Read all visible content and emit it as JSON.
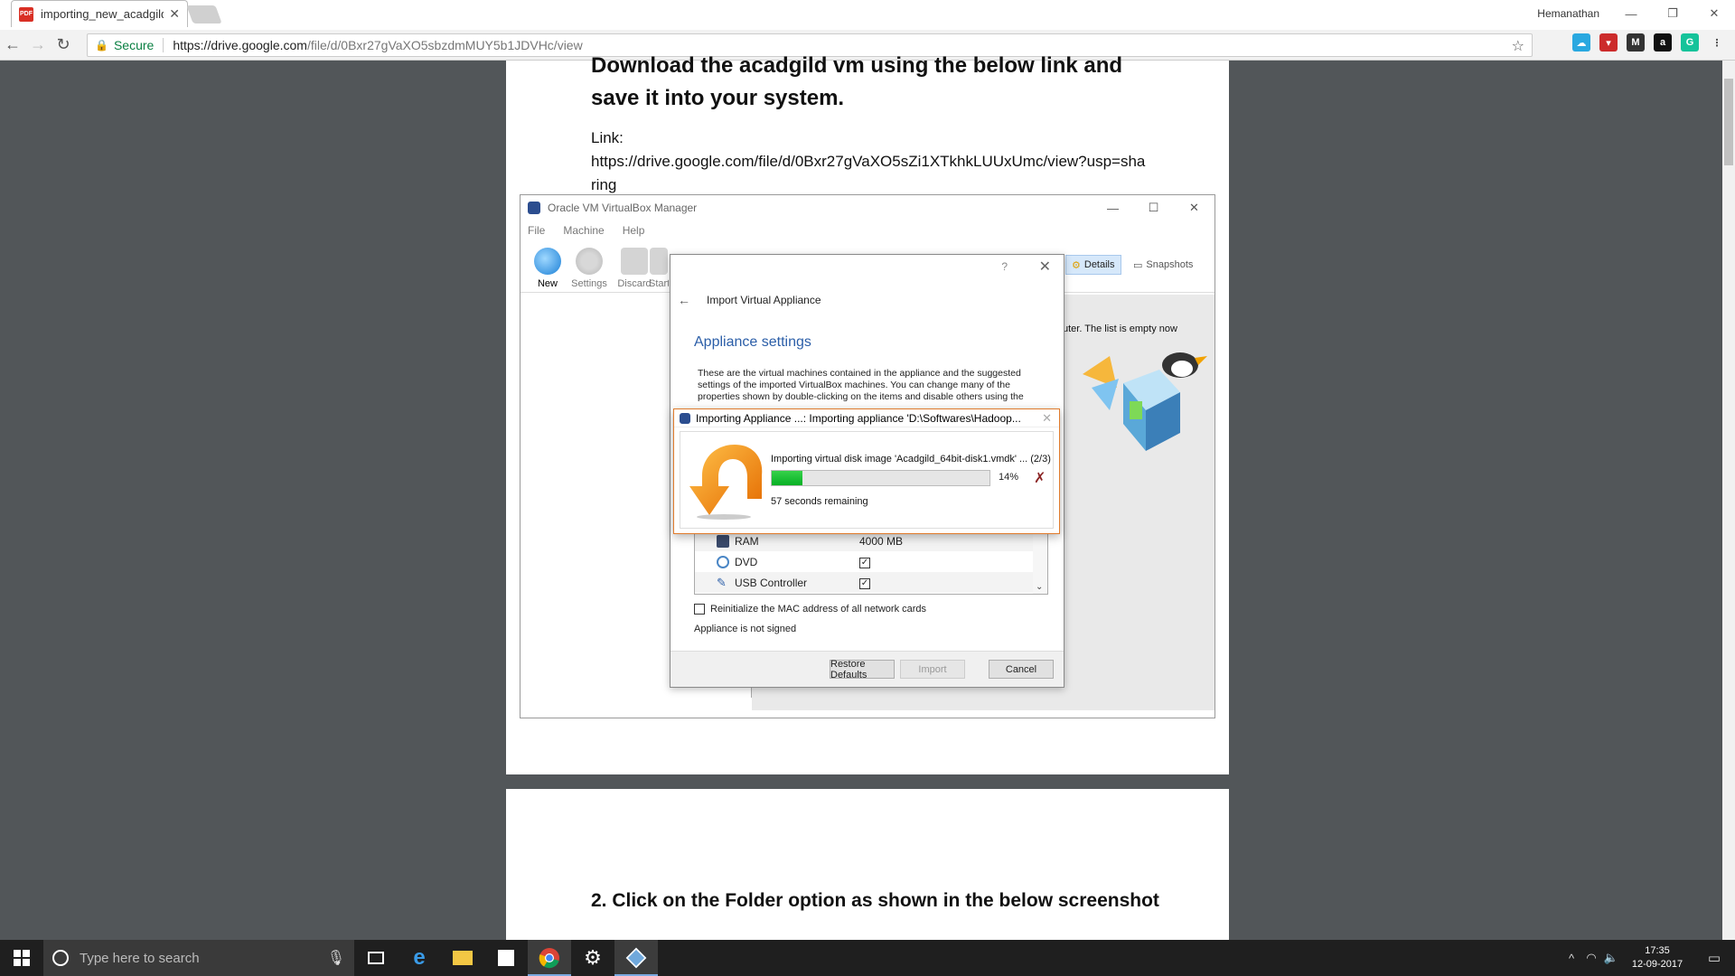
{
  "browser": {
    "tab_title": "importing_new_acadgild",
    "tab_icon_text": "PDF",
    "user_name": "Hemanathan",
    "secure_label": "Secure",
    "url_host": "https://drive.google.com",
    "url_path": "/file/d/0Bxr27gVaXO5sbzdmMUY5b1JDVHc/view"
  },
  "document": {
    "heading_line1": "Download the acadgild vm using the below link and",
    "heading_line2": "save it into your system.",
    "link_label": "Link:",
    "link_line1": "https://drive.google.com/file/d/0Bxr27gVaXO5sZi1XTkhkLUUxUmc/view?usp=sha",
    "link_line2": "ring",
    "step2": "2. Click on the Folder option as shown in the below screenshot"
  },
  "virtualbox": {
    "title": "Oracle VM VirtualBox Manager",
    "menu": [
      "File",
      "Machine",
      "Help"
    ],
    "tools": [
      "New",
      "Settings",
      "Discard",
      "Start"
    ],
    "details_label": "Details",
    "snapshots_label": "Snapshots",
    "empty_text": "uter. The list is empty now"
  },
  "wizard": {
    "help": "?",
    "title": "Import Virtual Appliance",
    "subtitle": "Appliance settings",
    "description": "These are the virtual machines contained in the appliance and the suggested settings of the imported VirtualBox machines. You can change many of the properties shown by double-clicking on the items and disable others using the check boxes below.",
    "rows": [
      {
        "label": "RAM",
        "value": "4000 MB"
      },
      {
        "label": "DVD",
        "value": ""
      },
      {
        "label": "USB Controller",
        "value": ""
      }
    ],
    "mac_label": "Reinitialize the MAC address of all network cards",
    "signed_label": "Appliance is not signed",
    "restore_btn": "Restore Defaults",
    "import_btn": "Import",
    "cancel_btn": "Cancel"
  },
  "progress": {
    "title": "Importing Appliance ...: Importing appliance 'D:\\Softwares\\Hadoop...",
    "message": "Importing virtual disk image 'Acadgild_64bit-disk1.vmdk' ... (2/3)",
    "percent_value": 14,
    "percent_label": "14%",
    "remaining": "57 seconds remaining"
  },
  "taskbar": {
    "search_placeholder": "Type here to search",
    "time": "17:35",
    "date": "12-09-2017"
  },
  "colors": {
    "accent_blue": "#2b5ea8",
    "progress_green": "#06b025",
    "dialog_border": "#e07b2c",
    "viewer_bg": "#525659"
  }
}
